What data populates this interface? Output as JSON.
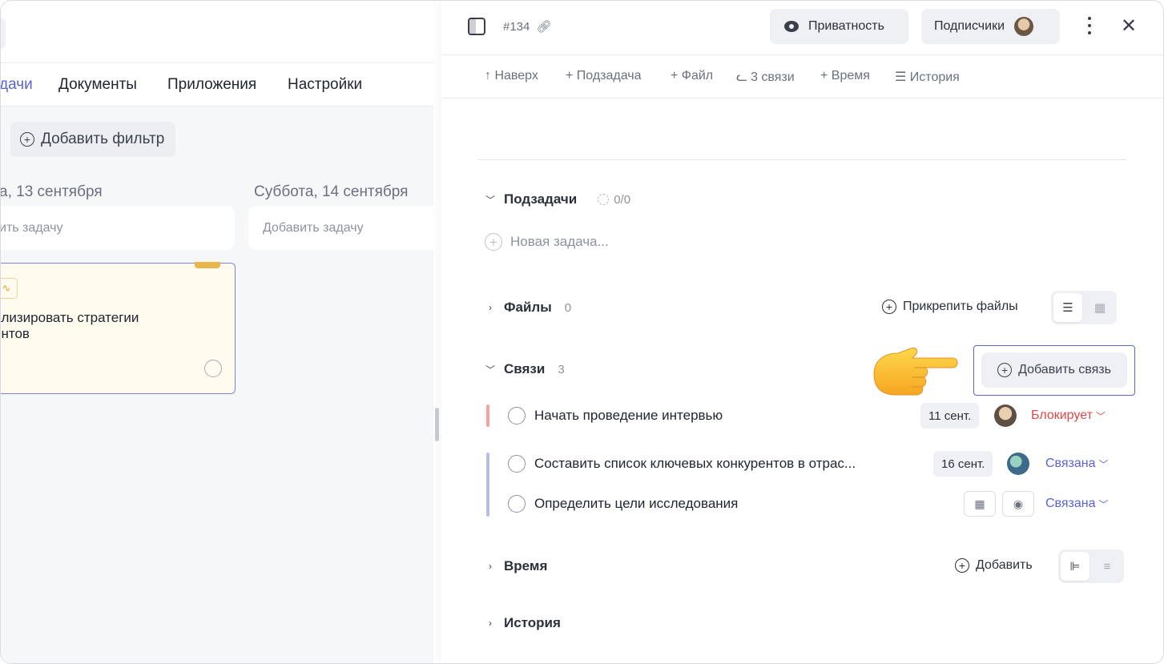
{
  "left": {
    "nav": [
      "дачи",
      "Документы",
      "Приложения",
      "Настройки"
    ],
    "add_filter": "Добавить фильтр",
    "columns": [
      {
        "title": "а, 13 сентября",
        "add_task": "ить задачу"
      },
      {
        "title": "Суббота, 14 сентября",
        "add_task": "Добавить задачу"
      }
    ],
    "card": {
      "title": "ализировать стратегии\nентов"
    }
  },
  "panel": {
    "task_id": "#134",
    "privacy": "Приватность",
    "subscribers": "Подписчики",
    "toolbar": {
      "up": "Наверх",
      "subtask": "Подзадача",
      "file": "Файл",
      "links": "3 связи",
      "time": "Время",
      "history": "История"
    },
    "subtasks": {
      "title": "Подзадачи",
      "progress": "0/0",
      "new_task": "Новая задача..."
    },
    "files": {
      "title": "Файлы",
      "count": "0",
      "attach": "Прикрепить файлы"
    },
    "links": {
      "title": "Связи",
      "count": "3",
      "add": "Добавить связь",
      "items": [
        {
          "name": "Начать проведение интервью",
          "date": "11 сент.",
          "relation": "Блокирует",
          "bar_color": "#f4a3a3"
        },
        {
          "name": "Составить список ключевых конкурентов в отрас...",
          "date": "16 сент.",
          "relation": "Связана",
          "bar_color": "#b9bcf0"
        },
        {
          "name": "Определить цели исследования",
          "date": "",
          "relation": "Связана",
          "bar_color": "#b9bcf0"
        }
      ]
    },
    "time": {
      "title": "Время",
      "add": "Добавить"
    },
    "history": {
      "title": "История"
    }
  },
  "icons": [
    "sidebar-toggle-icon",
    "link-icon",
    "eye-icon",
    "kebab-icon",
    "close-icon",
    "pointing-hand-icon",
    "calendar-icon",
    "user-icon"
  ]
}
